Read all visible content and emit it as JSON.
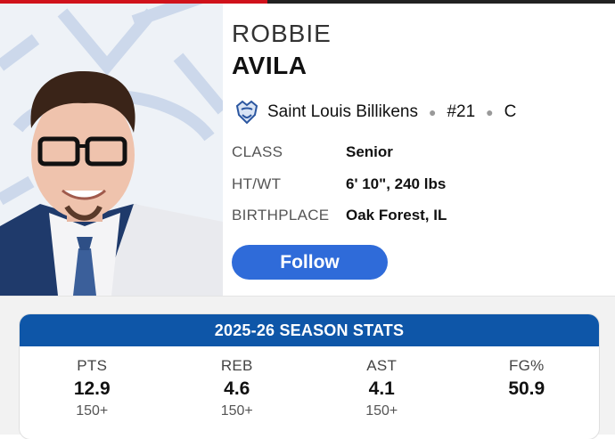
{
  "player": {
    "first_name": "ROBBIE",
    "last_name": "AVILA",
    "team": "Saint Louis Billikens",
    "number": "#21",
    "position": "C",
    "follow_label": "Follow"
  },
  "bio": [
    {
      "label": "CLASS",
      "value": "Senior"
    },
    {
      "label": "HT/WT",
      "value": "6' 10\", 240 lbs"
    },
    {
      "label": "BIRTHPLACE",
      "value": "Oak Forest, IL"
    }
  ],
  "stats": {
    "title": "2025-26 SEASON STATS",
    "items": [
      {
        "label": "PTS",
        "value": "12.9",
        "sub": "150+"
      },
      {
        "label": "REB",
        "value": "4.6",
        "sub": "150+"
      },
      {
        "label": "AST",
        "value": "4.1",
        "sub": "150+"
      },
      {
        "label": "FG%",
        "value": "50.9",
        "sub": ""
      }
    ]
  },
  "colors": {
    "accent_red": "#d0121b",
    "follow_blue": "#2f6bd9",
    "stats_header_blue": "#0e56a8"
  },
  "icons": {
    "team_logo": "billiken-logo-icon"
  }
}
